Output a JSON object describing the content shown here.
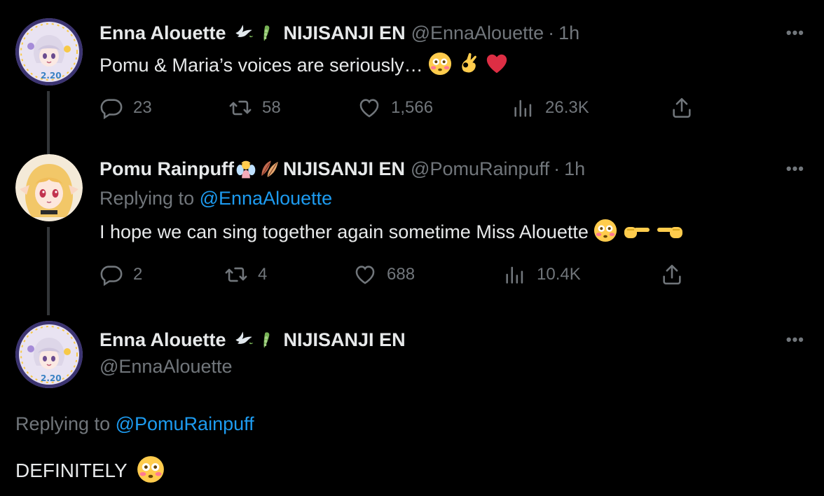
{
  "tweets": [
    {
      "name": "Enna Alouette",
      "badges": [
        "dove-emoji",
        "pea-pod-emoji"
      ],
      "affiliation": "NIJISANJI EN",
      "handle": "@EnnaAlouette",
      "separator": "·",
      "time": "1h",
      "text": "Pomu & Maria’s voices are seriously…",
      "text_emojis": [
        "flushed-face-emoji",
        "ok-hand-emoji",
        "red-heart-emoji"
      ],
      "more": "•••",
      "metrics": {
        "replies": "23",
        "retweets": "58",
        "likes": "1,566",
        "views": "26.3K"
      }
    },
    {
      "name": "Pomu Rainpuff",
      "badges": [
        "fairy-emoji",
        "leaves-emoji"
      ],
      "affiliation": "NIJISANJI EN",
      "handle": "@PomuRainpuff",
      "separator": "·",
      "time": "1h",
      "replying_prefix": "Replying to",
      "replying_to": "@EnnaAlouette",
      "text": "I hope we can sing together again sometime Miss Alouette",
      "text_emojis": [
        "flushed-face-emoji",
        "pointing-right-emoji",
        "pointing-left-emoji"
      ],
      "more": "•••",
      "metrics": {
        "replies": "2",
        "retweets": "4",
        "likes": "688",
        "views": "10.4K"
      }
    },
    {
      "name": "Enna Alouette",
      "badges": [
        "dove-emoji",
        "pea-pod-emoji"
      ],
      "affiliation": "NIJISANJI EN",
      "handle": "@EnnaAlouette",
      "replying_prefix": "Replying to",
      "replying_to": "@PomuRainpuff",
      "text": "DEFINITELY",
      "text_emojis": [
        "flushed-face-emoji"
      ],
      "more": "•••"
    }
  ],
  "colors": {
    "background": "#000000",
    "text": "#e7e9ea",
    "secondary": "#71767b",
    "link": "#1d9bf0",
    "thread_line": "#333639"
  }
}
